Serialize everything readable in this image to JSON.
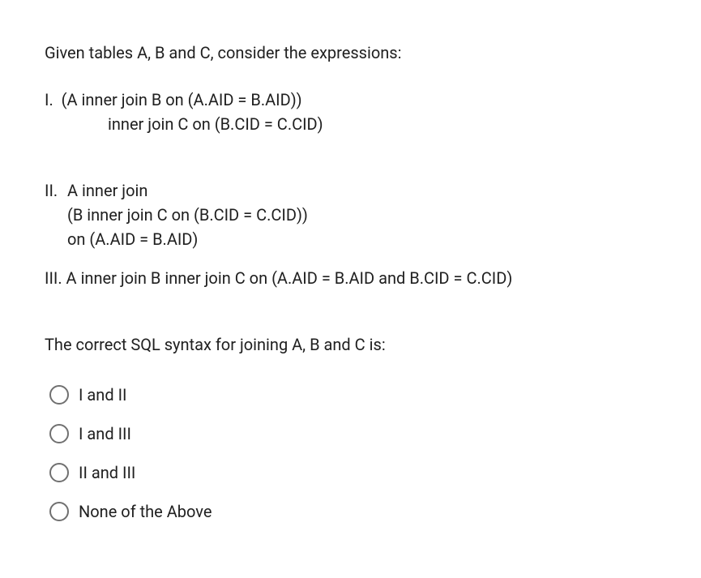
{
  "intro": "Given tables A, B and C, consider the expressions:",
  "expressions": {
    "i": {
      "marker": "I.  ",
      "line1": "(A inner join B on (A.AID = B.AID))",
      "line2": "inner join C on (B.CID = C.CID)"
    },
    "ii": {
      "marker": "II.",
      "line1": "A inner join",
      "line2": "(B inner join C on (B.CID = C.CID))",
      "line3": "on (A.AID = B.AID)"
    },
    "iii": {
      "marker": "III.",
      "line1": " A inner join B inner join C on (A.AID = B.AID and B.CID = C.CID)"
    }
  },
  "question": "The correct SQL syntax for joining A, B and C is:",
  "options": [
    {
      "label": "I and II"
    },
    {
      "label": "I and III"
    },
    {
      "label": "II and III"
    },
    {
      "label": "None of the Above"
    }
  ]
}
